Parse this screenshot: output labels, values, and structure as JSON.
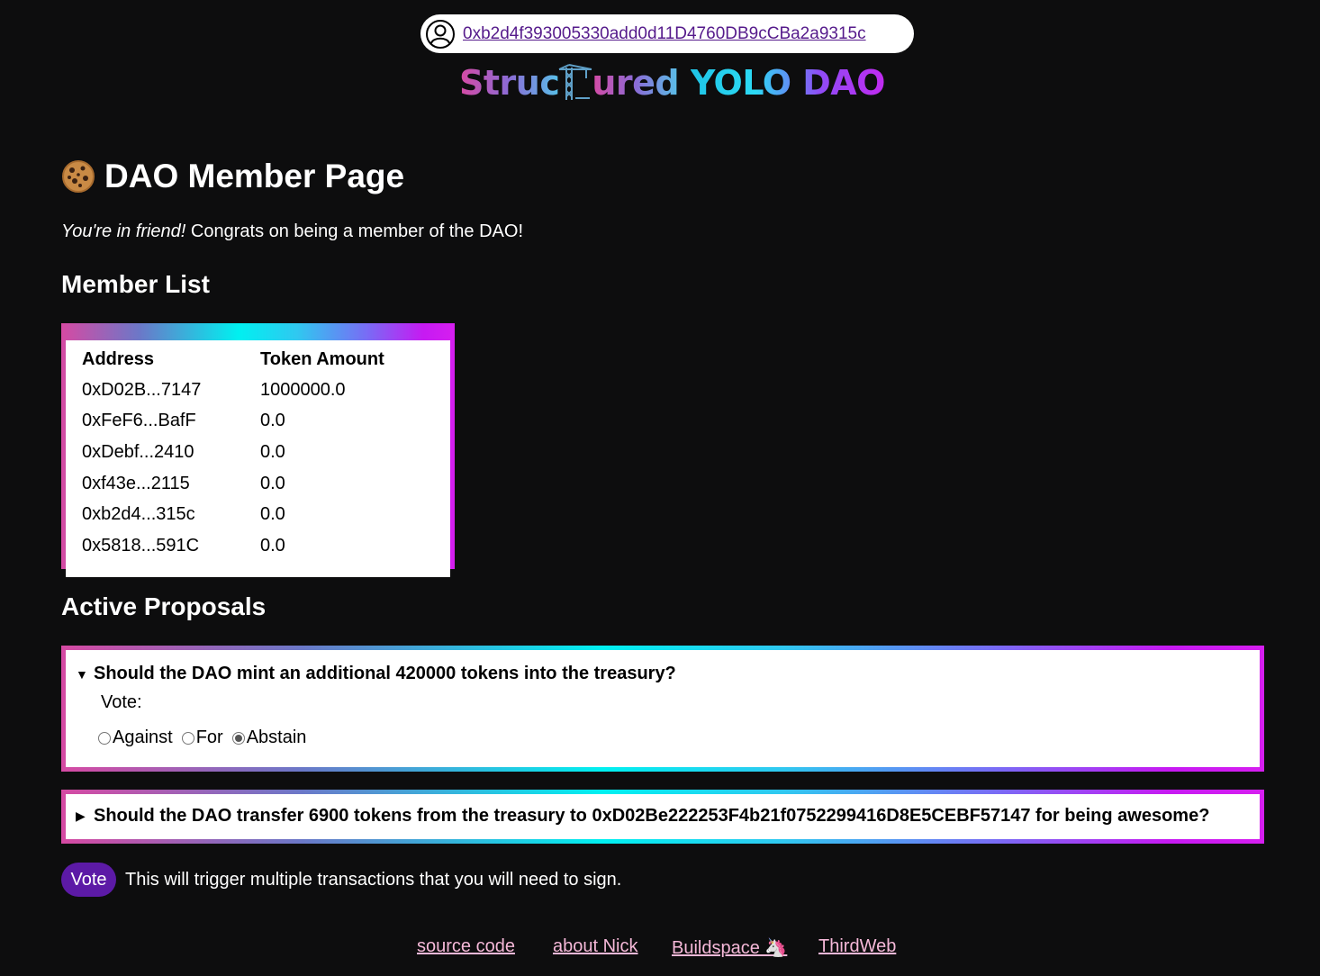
{
  "wallet": {
    "address": "0xb2d4f393005330add0d11D4760DB9cCBa2a9315c"
  },
  "logo": {
    "part1": "Struc",
    "part2": "ured",
    "part3": "YOLO DAO"
  },
  "page": {
    "title": "DAO Member Page",
    "intro_em": "You're in friend!",
    "intro_rest": " Congrats on being a member of the DAO!"
  },
  "members": {
    "heading": "Member List",
    "columns": [
      "Address",
      "Token Amount"
    ],
    "rows": [
      {
        "address": "0xD02B...7147",
        "amount": "1000000.0"
      },
      {
        "address": "0xFeF6...BafF",
        "amount": "0.0"
      },
      {
        "address": "0xDebf...2410",
        "amount": "0.0"
      },
      {
        "address": "0xf43e...2115",
        "amount": "0.0"
      },
      {
        "address": "0xb2d4...315c",
        "amount": "0.0"
      },
      {
        "address": "0x5818...591C",
        "amount": "0.0"
      }
    ]
  },
  "proposals": {
    "heading": "Active Proposals",
    "items": [
      {
        "title": "Should the DAO mint an additional 420000 tokens into the treasury?",
        "vote_label": "Vote:",
        "options": [
          "Against",
          "For",
          "Abstain"
        ],
        "selected": "Abstain",
        "expanded": true
      },
      {
        "title": "Should the DAO transfer 6900 tokens from the treasury to 0xD02Be222253F4b21f0752299416D8E5CEBF57147 for being awesome?",
        "expanded": false
      }
    ]
  },
  "vote": {
    "button_label": "Vote",
    "note": "This will trigger multiple transactions that you will need to sign."
  },
  "footer": {
    "links": [
      "source code",
      "about Nick",
      "Buildspace 🦄",
      "ThirdWeb"
    ]
  },
  "colors": {
    "background": "#0d0d0e",
    "vote_button": "#5c1aa6",
    "footer_link": "#f5b8d8",
    "wallet_link": "#551a8b"
  }
}
